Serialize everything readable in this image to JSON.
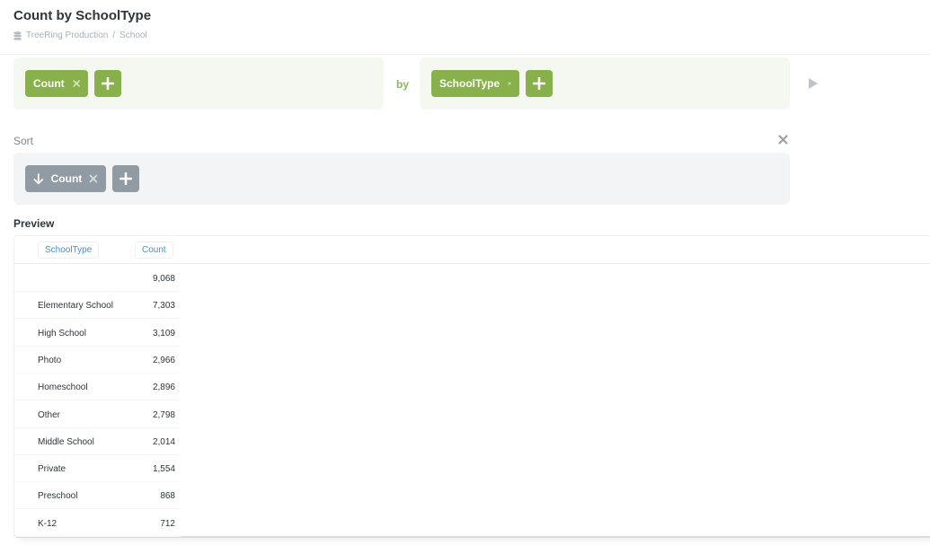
{
  "header": {
    "title": "Count by SchoolType",
    "breadcrumb": {
      "database": "TreeRing Production",
      "separator": "/",
      "table": "School"
    }
  },
  "query": {
    "aggregation": {
      "label": "Count",
      "add_icon": "plus-icon",
      "remove_icon": "close-icon"
    },
    "by_label": "by",
    "breakout": {
      "label": "SchoolType",
      "add_icon": "plus-icon",
      "remove_icon": "close-icon"
    },
    "run_icon": "play-icon"
  },
  "sort": {
    "section_label": "Sort",
    "item": {
      "label": "Count",
      "direction": "descending",
      "direction_icon": "arrow-down-icon"
    },
    "close_icon": "close-icon"
  },
  "preview": {
    "label": "Preview",
    "columns": [
      "SchoolType",
      "Count"
    ],
    "rows": [
      {
        "SchoolType": "",
        "Count": "9,068"
      },
      {
        "SchoolType": "Elementary School",
        "Count": "7,303"
      },
      {
        "SchoolType": "High School",
        "Count": "3,109"
      },
      {
        "SchoolType": "Photo",
        "Count": "2,966"
      },
      {
        "SchoolType": "Homeschool",
        "Count": "2,896"
      },
      {
        "SchoolType": "Other",
        "Count": "2,798"
      },
      {
        "SchoolType": "Middle School",
        "Count": "2,014"
      },
      {
        "SchoolType": "Private",
        "Count": "1,554"
      },
      {
        "SchoolType": "Preschool",
        "Count": "868"
      },
      {
        "SchoolType": "K-12",
        "Count": "712"
      }
    ]
  },
  "colors": {
    "accent_green": "#88b04b",
    "green_panel": "#f5f8f0",
    "sort_gray": "#919ba3",
    "gray_panel": "#f2f4f5",
    "link_blue": "#4c8ec0",
    "text_dark": "#2e353b"
  }
}
